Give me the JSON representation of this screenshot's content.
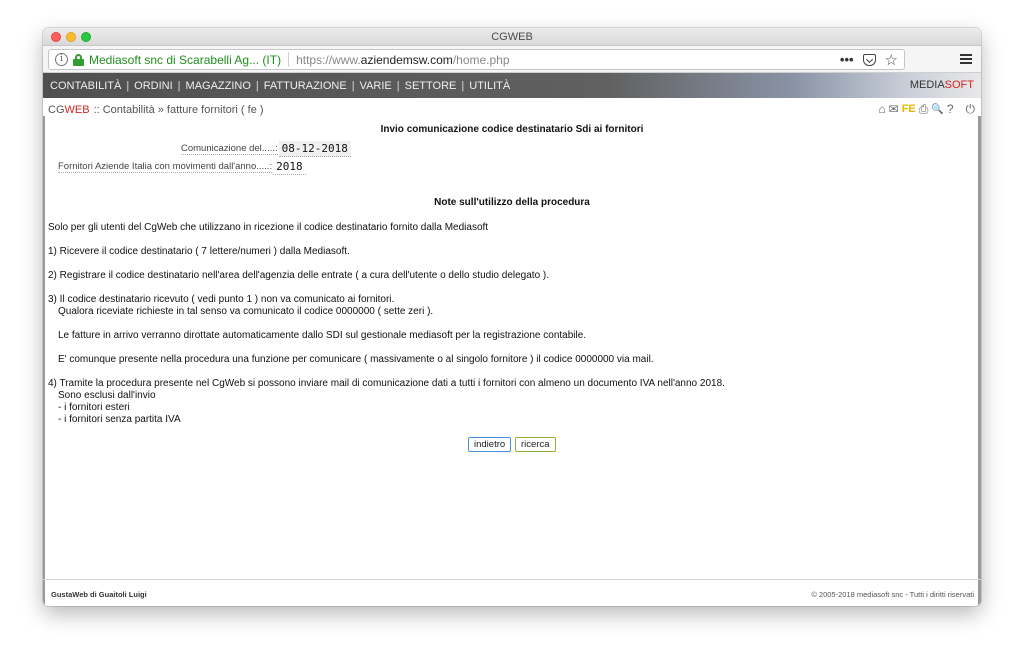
{
  "window": {
    "title": "CGWEB"
  },
  "browser": {
    "site_name": "Mediasoft snc di Scarabelli Ag... (IT)",
    "url_prefix": "https://www.",
    "url_domain": "aziendemsw.com",
    "url_path": "/home.php",
    "more_label": "•••",
    "star_glyph": "☆"
  },
  "nav": {
    "items": [
      "CONTABILITÀ",
      "ORDINI",
      "MAGAZZINO",
      "FATTURAZIONE",
      "VARIE",
      "SETTORE",
      "UTILITÀ"
    ],
    "separator": "|",
    "brand_part1": "MEDIA",
    "brand_part2": "SOFT"
  },
  "breadcrumb": {
    "logo_part1": "CG",
    "logo_part2": "WEB",
    "path": ":: Contabilità » fatture fornitori ( fe )"
  },
  "tools": {
    "home_icon": "⌂",
    "mail_icon": "✉",
    "fe_label": "FE",
    "print_icon": "⎙",
    "search_icon": "🔍",
    "help_icon": "?",
    "power_icon": "⏻"
  },
  "main": {
    "title": "Invio comunicazione codice destinatario Sdi ai fornitori",
    "field1_label": "Comunicazione del.....:",
    "field1_value": "08-12-2018",
    "field2_label": "Fornitori Aziende Italia con movimenti dall'anno.....:",
    "field2_value": "2018",
    "notes_title": "Note sull'utilizzo della procedura",
    "intro": "Solo per gli utenti del CgWeb che utilizzano in ricezione il codice destinatario fornito dalla Mediasoft",
    "p1": "1) Ricevere il codice destinatario ( 7 lettere/numeri ) dalla Mediasoft.",
    "p2": "2) Registrare il codice destinatario nell'area dell'agenzia delle entrate ( a cura dell'utente o dello studio delegato ).",
    "p3a": "3) Il codice destinatario ricevuto ( vedi punto 1 ) non va comunicato ai fornitori.",
    "p3b": "Qualora riceviate richieste in tal senso va comunicato il codice 0000000 ( sette zeri ).",
    "p3c": "Le fatture in arrivo verranno dirottate automaticamente dallo SDI sul gestionale mediasoft per la registrazione contabile.",
    "p3d": "E' comunque presente nella procedura una funzione per comunicare ( massivamente o al singolo fornitore ) il codice 0000000 via mail.",
    "p4a": "4) Tramite la procedura presente nel CgWeb si possono inviare mail di comunicazione dati a tutti i fornitori con almeno un documento IVA nell'anno 2018.",
    "p4b": "Sono esclusi dall'invio",
    "p4c": "- i fornitori esteri",
    "p4d": "- i fornitori senza partita IVA",
    "back_button": "indietro",
    "search_button": "ricerca"
  },
  "footer": {
    "left": "GustaWeb di Guaitoli Luigi",
    "right": "© 2005-2018 mediasoft snc - Tutti i diritti riservati"
  }
}
